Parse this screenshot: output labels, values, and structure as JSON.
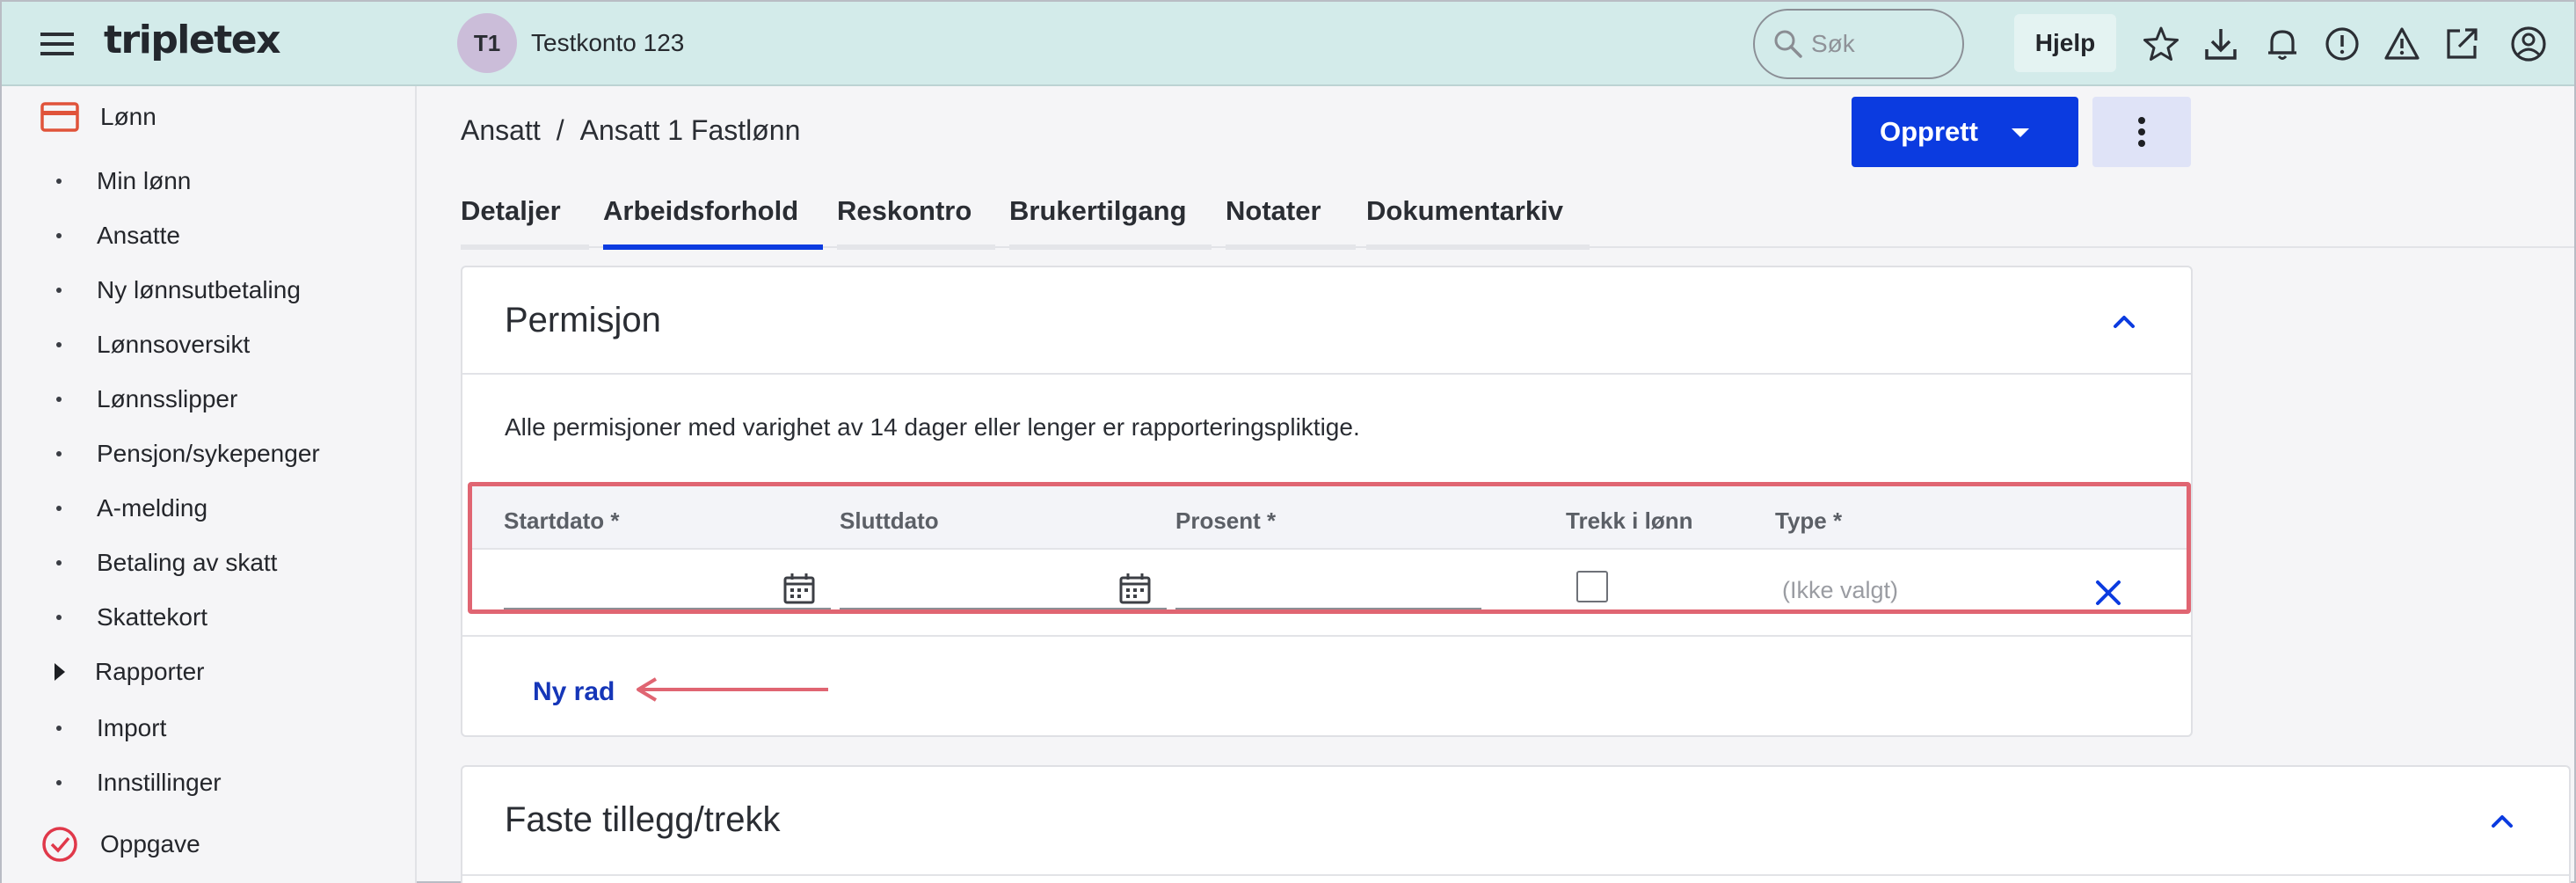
{
  "colors": {
    "topbar_bg": "#d3ebea",
    "primary": "#0b3be0",
    "link": "#1536b8",
    "annotation": "#e06572",
    "salary_module": "#e0533a",
    "task_module": "#e0384a"
  },
  "topbar": {
    "logo": "tripletex",
    "company_initials": "T1",
    "company_name": "Testkonto 123",
    "search_placeholder": "Søk",
    "help_label": "Hjelp",
    "icons": [
      "star-icon",
      "download-icon",
      "bell-icon",
      "alert-circle-icon",
      "warning-triangle-icon",
      "external-link-icon",
      "user-account-icon"
    ]
  },
  "sidebar": {
    "module_salary": "Lønn",
    "items": [
      "Min lønn",
      "Ansatte",
      "Ny lønnsutbetaling",
      "Lønnsoversikt",
      "Lønnsslipper",
      "Pensjon/sykepenger",
      "A-melding",
      "Betaling av skatt",
      "Skattekort",
      "Rapporter",
      "Import",
      "Innstillinger"
    ],
    "module_task": "Oppgave"
  },
  "breadcrumb": {
    "parent": "Ansatt",
    "separator": "/",
    "current": "Ansatt 1 Fastlønn"
  },
  "actions": {
    "create_label": "Opprett"
  },
  "tabs": [
    "Detaljer",
    "Arbeidsforhold",
    "Reskontro",
    "Brukertilgang",
    "Notater",
    "Dokumentarkiv"
  ],
  "active_tab": "Arbeidsforhold",
  "permisjon": {
    "title": "Permisjon",
    "info": "Alle permisjoner med varighet av 14 dager eller lenger er rapporteringspliktige.",
    "columns": {
      "start": "Startdato *",
      "end": "Sluttdato",
      "percent": "Prosent *",
      "deduct": "Trekk i lønn",
      "type": "Type *"
    },
    "row": {
      "start": "",
      "end": "",
      "percent": "",
      "deduct_checked": false,
      "type": "(Ikke valgt)"
    },
    "new_row_label": "Ny rad"
  },
  "faste": {
    "title": "Faste tillegg/trekk"
  }
}
